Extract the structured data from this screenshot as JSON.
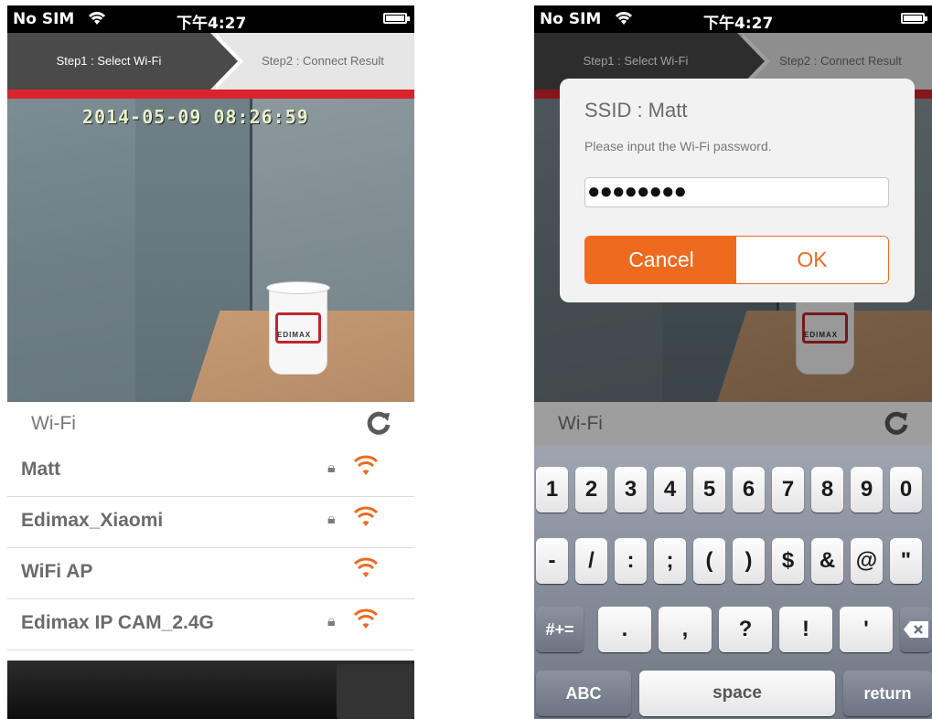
{
  "status": {
    "carrier": "No SIM",
    "time": "下午4:27"
  },
  "steps": {
    "step1": "Step1 : Select Wi-Fi",
    "step2": "Step2 : Connect Result"
  },
  "camera": {
    "timestamp": "2014-05-09 08:26:59",
    "cup_brand": "EDIMAX"
  },
  "wifi": {
    "header": "Wi-Fi",
    "networks": [
      {
        "name": "Matt",
        "locked": true
      },
      {
        "name": "Edimax_Xiaomi",
        "locked": true
      },
      {
        "name": "WiFi AP",
        "locked": false
      },
      {
        "name": "Edimax IP CAM_2.4G",
        "locked": true
      }
    ]
  },
  "dialog": {
    "ssid": "SSID : Matt",
    "hint": "Please input the Wi-Fi password.",
    "password_masked": "●●●●●●●●",
    "cancel": "Cancel",
    "ok": "OK"
  },
  "keyboard": {
    "row1": [
      "1",
      "2",
      "3",
      "4",
      "5",
      "6",
      "7",
      "8",
      "9",
      "0"
    ],
    "row2": [
      "-",
      "/",
      ":",
      ";",
      "(",
      ")",
      "$",
      "&",
      "@",
      "\""
    ],
    "row3_mode": "#+=",
    "row3": [
      ".",
      ",",
      "?",
      "!",
      "'"
    ],
    "abc": "ABC",
    "space": "space",
    "return": "return"
  },
  "colors": {
    "accent": "#ee6a1e",
    "red_bar": "#d9242e",
    "step_active": "#4a4a4a"
  }
}
